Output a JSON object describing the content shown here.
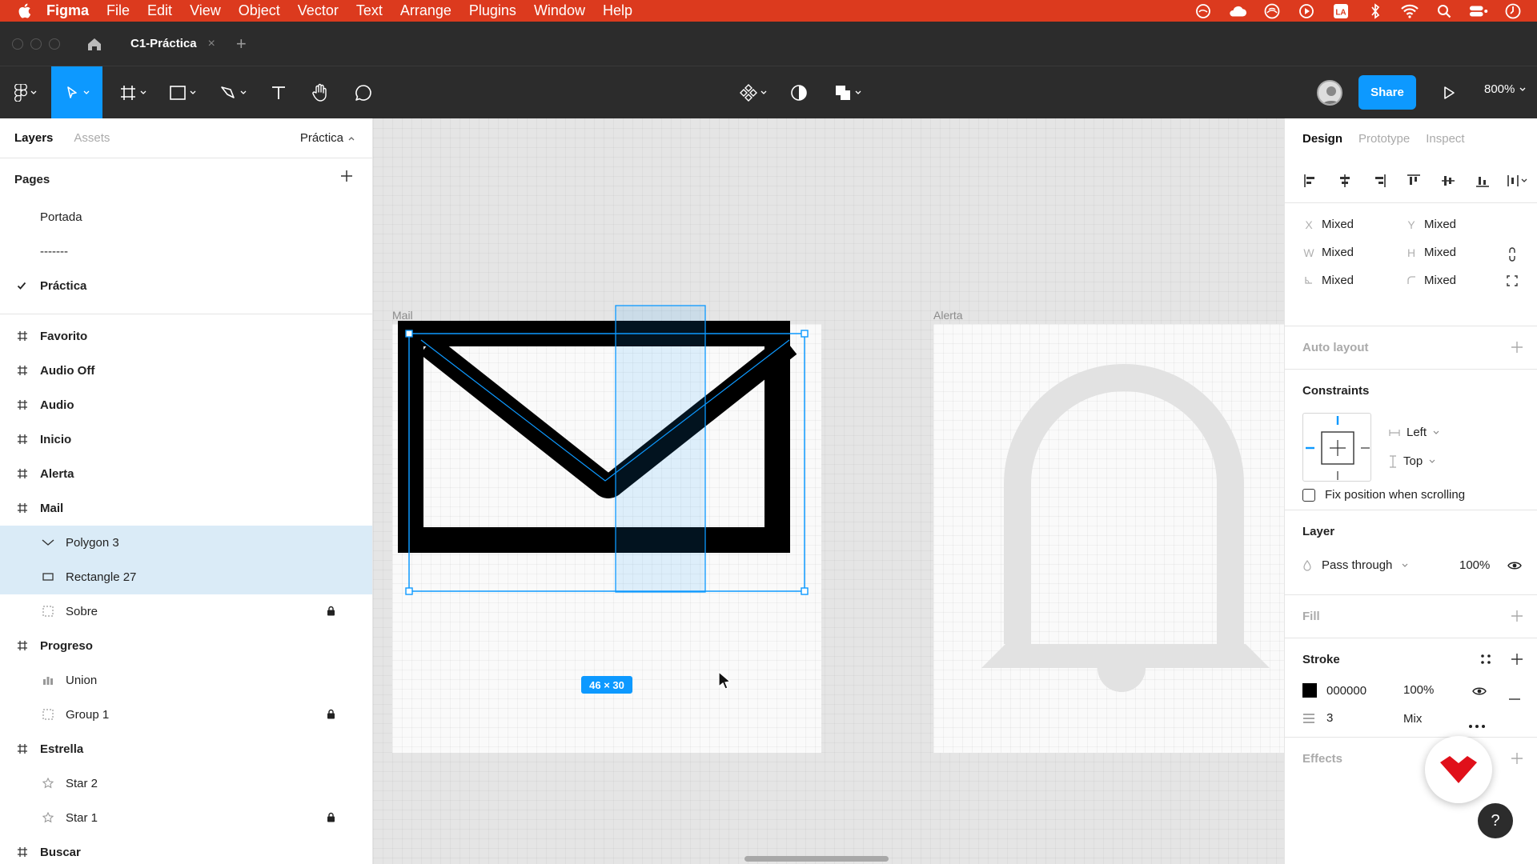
{
  "menubar": {
    "app_name": "Figma",
    "items": [
      "File",
      "Edit",
      "View",
      "Object",
      "Vector",
      "Text",
      "Arrange",
      "Plugins",
      "Window",
      "Help"
    ],
    "tray_icons": [
      "creative-cloud-icon",
      "cloud-icon",
      "adobe-icon",
      "play-circle-icon",
      "la-icon",
      "bluetooth-icon",
      "wifi-icon",
      "search-icon",
      "control-center-icon",
      "clock-icon"
    ]
  },
  "tabbar": {
    "file_name": "C1-Práctica",
    "close_glyph": "×",
    "new_tab_glyph": "+"
  },
  "toolbar": {
    "share_label": "Share",
    "zoom_label": "800%"
  },
  "left_panel": {
    "tabs": {
      "layers": "Layers",
      "assets": "Assets"
    },
    "current_page": "Práctica",
    "pages_title": "Pages",
    "pages": [
      {
        "name": "Portada",
        "current": false
      },
      {
        "name": "-------",
        "current": false
      },
      {
        "name": "Práctica",
        "current": true
      }
    ],
    "layers": [
      {
        "name": "Favorito",
        "kind": "frame"
      },
      {
        "name": "Audio Off",
        "kind": "frame"
      },
      {
        "name": "Audio",
        "kind": "frame"
      },
      {
        "name": "Inicio",
        "kind": "frame"
      },
      {
        "name": "Alerta",
        "kind": "frame"
      },
      {
        "name": "Mail",
        "kind": "frame"
      },
      {
        "name": "Polygon 3",
        "kind": "polygon",
        "selected": true
      },
      {
        "name": "Rectangle 27",
        "kind": "rectangle",
        "selected": true
      },
      {
        "name": "Sobre",
        "kind": "group-dashed",
        "locked": true
      },
      {
        "name": "Progreso",
        "kind": "frame"
      },
      {
        "name": "Union",
        "kind": "union"
      },
      {
        "name": "Group 1",
        "kind": "group-dashed",
        "locked": true
      },
      {
        "name": "Estrella",
        "kind": "frame"
      },
      {
        "name": "Star 2",
        "kind": "star"
      },
      {
        "name": "Star 1",
        "kind": "star",
        "locked": true
      },
      {
        "name": "Buscar",
        "kind": "frame"
      }
    ]
  },
  "canvas": {
    "frame_mail_label": "Mail",
    "frame_alerta_label": "Alerta",
    "selection_size": "46 × 30",
    "stroke_color": "#000000",
    "selection_color": "#0d99ff"
  },
  "right_panel": {
    "tabs": {
      "design": "Design",
      "prototype": "Prototype",
      "inspect": "Inspect"
    },
    "props": {
      "x_label": "X",
      "x_value": "Mixed",
      "y_label": "Y",
      "y_value": "Mixed",
      "w_label": "W",
      "w_value": "Mixed",
      "h_label": "H",
      "h_value": "Mixed",
      "rot_value": "Mixed",
      "radius_value": "Mixed"
    },
    "auto_layout": "Auto layout",
    "constraints": {
      "title": "Constraints",
      "horizontal": "Left",
      "vertical": "Top",
      "fix_scroll": "Fix position when scrolling"
    },
    "layer": {
      "title": "Layer",
      "blend": "Pass through",
      "opacity": "100%"
    },
    "fill": "Fill",
    "stroke": {
      "title": "Stroke",
      "color_hex": "000000",
      "opacity": "100%",
      "weight": "3",
      "position": "Mix"
    },
    "effects": "Effects"
  },
  "colors": {
    "menubar": "#dc3a1e",
    "dark_ui": "#2c2c2c",
    "accent": "#0d99ff",
    "selected_layer": "#daebf7"
  }
}
